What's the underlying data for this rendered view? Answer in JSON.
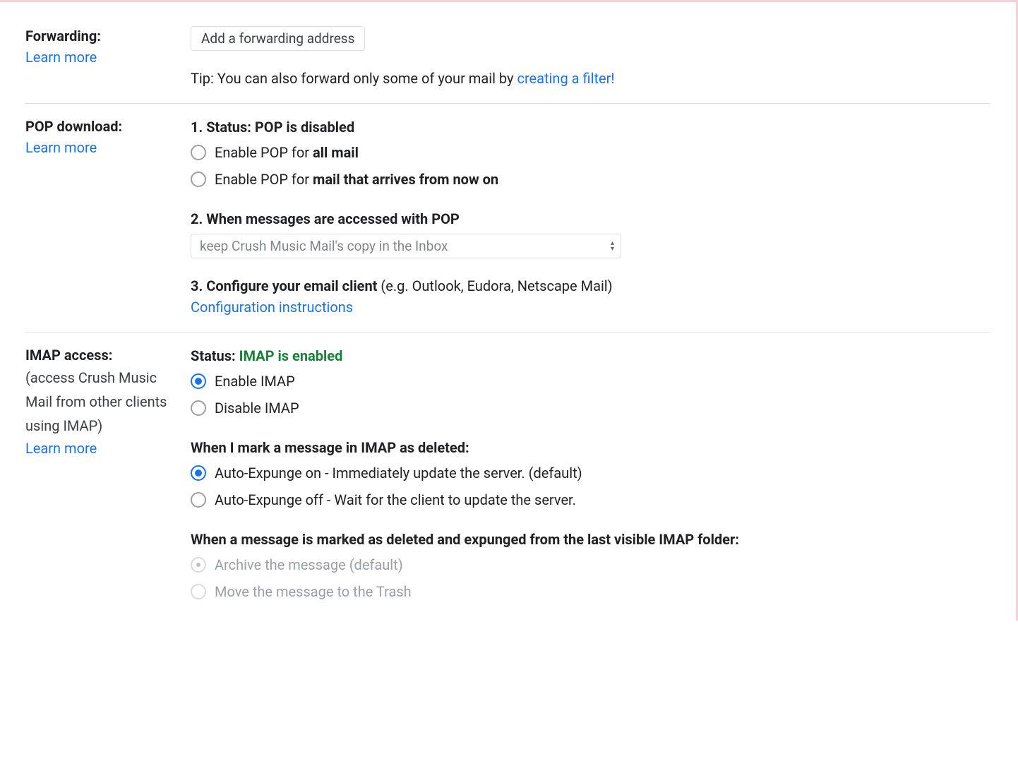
{
  "forwarding": {
    "title": "Forwarding:",
    "learn_more": "Learn more",
    "add_button": "Add a forwarding address",
    "tip_prefix": "Tip: You can also forward only some of your mail by ",
    "tip_link": "creating a filter!"
  },
  "pop": {
    "title": "POP download:",
    "learn_more": "Learn more",
    "status_prefix": "1. Status: ",
    "status_value": "POP is disabled",
    "opt_all_prefix": "Enable POP for ",
    "opt_all_bold": "all mail",
    "opt_new_prefix": "Enable POP for ",
    "opt_new_bold": "mail that arrives from now on",
    "step2": "2. When messages are accessed with POP",
    "select_value": "keep Crush Music Mail's copy in the Inbox",
    "step3_bold": "3. Configure your email client ",
    "step3_hint": "(e.g. Outlook, Eudora, Netscape Mail)",
    "config_link": "Configuration instructions"
  },
  "imap": {
    "title": "IMAP access:",
    "subtitle": "(access Crush Music Mail from other clients using IMAP)",
    "learn_more": "Learn more",
    "status_prefix": "Status: ",
    "status_value": "IMAP is enabled",
    "opt_enable": "Enable IMAP",
    "opt_disable": "Disable IMAP",
    "deleted_heading": "When I mark a message in IMAP as deleted:",
    "expunge_on": "Auto-Expunge on - Immediately update the server. (default)",
    "expunge_off": "Auto-Expunge off - Wait for the client to update the server.",
    "expunged_heading": "When a message is marked as deleted and expunged from the last visible IMAP folder:",
    "archive": "Archive the message (default)",
    "trash": "Move the message to the Trash"
  }
}
